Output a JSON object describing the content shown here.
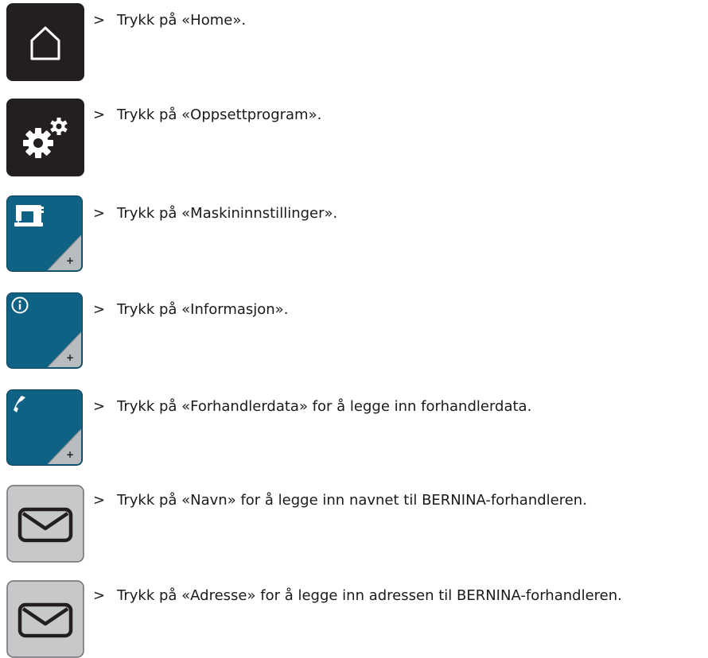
{
  "steps": [
    {
      "icon": "home-icon",
      "style": "dark",
      "prefix": ">",
      "text": "Trykk på «Home»."
    },
    {
      "icon": "gears-icon",
      "style": "dark",
      "prefix": ">",
      "text": "Trykk på «Oppsettprogram»."
    },
    {
      "icon": "sewing-machine-icon",
      "style": "blue",
      "prefix": ">",
      "text": "Trykk på «Maskininnstillinger»."
    },
    {
      "icon": "info-icon",
      "style": "blue",
      "prefix": ">",
      "text": "Trykk på «Informasjon»."
    },
    {
      "icon": "phone-icon",
      "style": "blue",
      "prefix": ">",
      "text": "Trykk på «Forhandlerdata» for å legge inn forhandlerdata."
    },
    {
      "icon": "envelope-icon",
      "style": "gray",
      "prefix": ">",
      "text": "Trykk på «Navn» for å legge inn navnet til BERNINA-forhandleren."
    },
    {
      "icon": "envelope-icon",
      "style": "gray",
      "prefix": ">",
      "text": "Trykk på «Adresse» for å legge inn adressen til BERNINA-forhandleren."
    }
  ],
  "colors": {
    "dark_button": "#231f20",
    "blue_button": "#0f6283",
    "gray_button": "#c7c8ca",
    "text": "#1a1a1a"
  }
}
